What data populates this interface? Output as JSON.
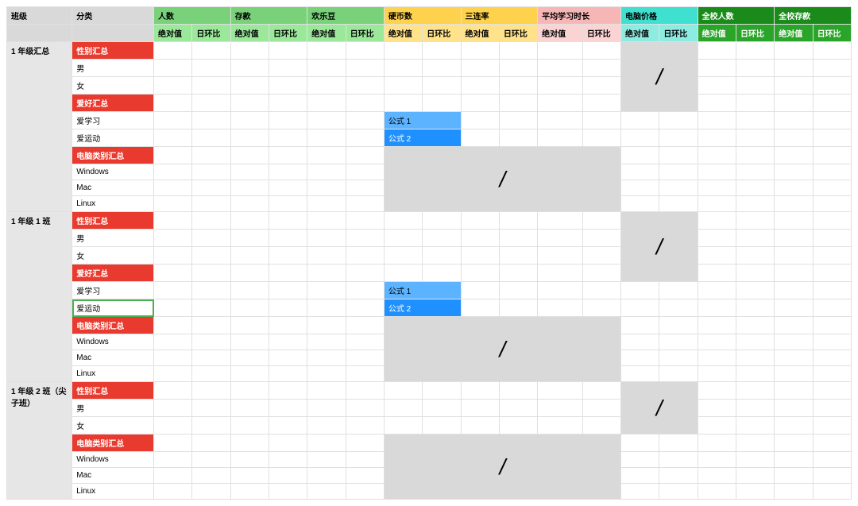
{
  "header": {
    "groupA": [
      "班级",
      "分类"
    ],
    "green": [
      "人数",
      "存款",
      "欢乐豆"
    ],
    "yellow": [
      "硬币数",
      "三连率"
    ],
    "pink": [
      "平均学习时长"
    ],
    "teal": [
      "电脑价格"
    ],
    "dgreen": [
      "全校人数",
      "全校存款"
    ],
    "sub": {
      "abs": "绝对值",
      "dod": "日环比"
    }
  },
  "formulas": {
    "f1": "公式 1",
    "f2": "公式 2"
  },
  "slash": "/",
  "classes": [
    {
      "name": "1 年级汇总",
      "rows": [
        {
          "label": "性别汇总",
          "style": "red"
        },
        {
          "label": "男",
          "style": "white"
        },
        {
          "label": "女",
          "style": "white"
        },
        {
          "label": "爱好汇总",
          "style": "red"
        },
        {
          "label": "爱学习",
          "style": "white",
          "formula": "f1"
        },
        {
          "label": "爱运动",
          "style": "white",
          "formula": "f2"
        },
        {
          "label": "电脑类别汇总",
          "style": "red"
        },
        {
          "label": "Windows",
          "style": "white"
        },
        {
          "label": "Mac",
          "style": "white"
        },
        {
          "label": "Linux",
          "style": "white"
        }
      ],
      "tealSlash": {
        "start": 0,
        "span": 4
      },
      "yellowSlash": {
        "start": 6,
        "span": 4
      },
      "hasHobby": true
    },
    {
      "name": "1 年级 1 班",
      "rows": [
        {
          "label": "性别汇总",
          "style": "red"
        },
        {
          "label": "男",
          "style": "white"
        },
        {
          "label": "女",
          "style": "white"
        },
        {
          "label": "爱好汇总",
          "style": "red"
        },
        {
          "label": "爱学习",
          "style": "white",
          "formula": "f1"
        },
        {
          "label": "爱运动",
          "style": "white",
          "formula": "f2",
          "selected": true
        },
        {
          "label": "电脑类别汇总",
          "style": "red"
        },
        {
          "label": "Windows",
          "style": "white"
        },
        {
          "label": "Mac",
          "style": "white"
        },
        {
          "label": "Linux",
          "style": "white"
        }
      ],
      "tealSlash": {
        "start": 0,
        "span": 4
      },
      "yellowSlash": {
        "start": 6,
        "span": 4
      },
      "hasHobby": true
    },
    {
      "name": "1 年级 2 班（尖子班）",
      "rows": [
        {
          "label": "性别汇总",
          "style": "red"
        },
        {
          "label": "男",
          "style": "white"
        },
        {
          "label": "女",
          "style": "white"
        },
        {
          "label": "电脑类别汇总",
          "style": "red"
        },
        {
          "label": "Windows",
          "style": "white"
        },
        {
          "label": "Mac",
          "style": "white"
        },
        {
          "label": "Linux",
          "style": "white"
        }
      ],
      "tealSlash": {
        "start": 0,
        "span": 3
      },
      "yellowSlash": {
        "start": 3,
        "span": 4
      },
      "hasHobby": false
    }
  ]
}
